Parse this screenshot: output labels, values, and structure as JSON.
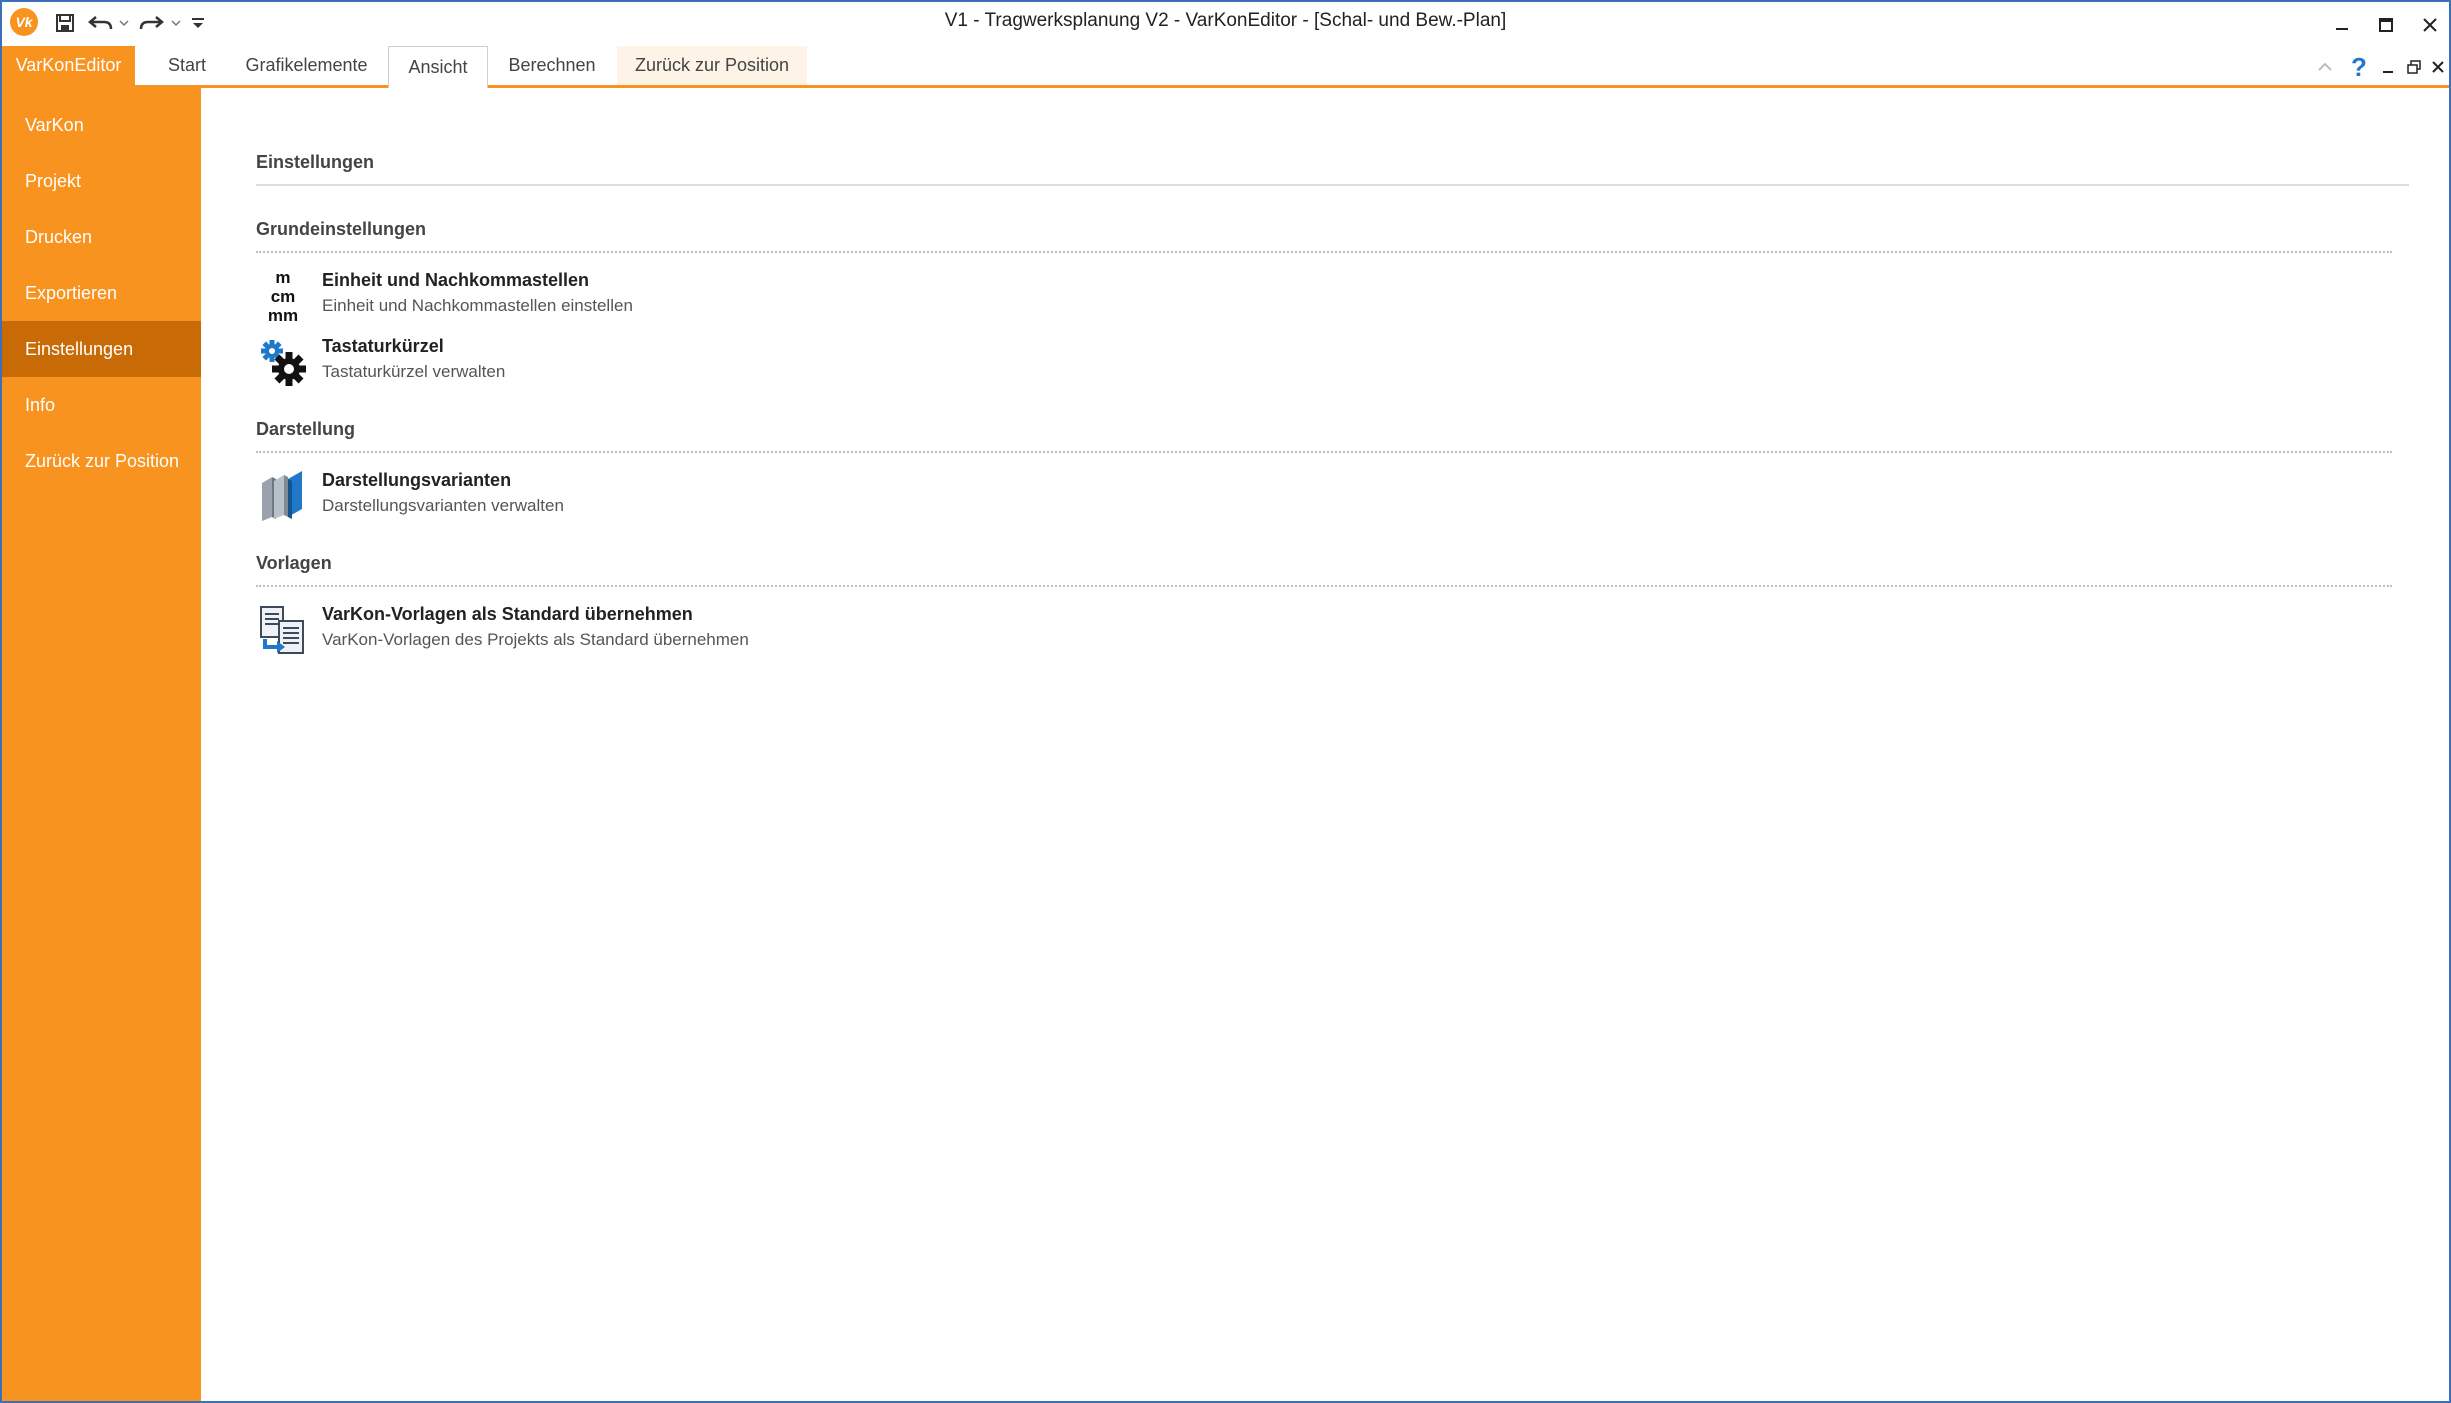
{
  "window": {
    "title": "V1 - Tragwerksplanung V2 - VarKonEditor - [Schal- und Bew.-Plan]",
    "logo_text": "Vk"
  },
  "ribbon": {
    "tabs": [
      {
        "label": "VarKonEditor"
      },
      {
        "label": "Start"
      },
      {
        "label": "Grafikelemente"
      },
      {
        "label": "Ansicht"
      },
      {
        "label": "Berechnen"
      },
      {
        "label": "Zurück zur Position"
      }
    ],
    "help_label": "?"
  },
  "sidebar": {
    "items": [
      {
        "label": "VarKon"
      },
      {
        "label": "Projekt"
      },
      {
        "label": "Drucken"
      },
      {
        "label": "Exportieren"
      },
      {
        "label": "Einstellungen"
      },
      {
        "label": "Info"
      },
      {
        "label": "Zurück zur Position"
      }
    ],
    "active_index": 4
  },
  "main": {
    "title": "Einstellungen",
    "sections": [
      {
        "title": "Grundeinstellungen",
        "entries": [
          {
            "title": "Einheit und Nachkommastellen",
            "description": "Einheit und Nachkommastellen einstellen",
            "icon": "units-icon",
            "icon_lines": [
              "m",
              "cm",
              "mm"
            ]
          },
          {
            "title": "Tastaturkürzel",
            "description": "Tastaturkürzel verwalten",
            "icon": "gears-icon"
          }
        ]
      },
      {
        "title": "Darstellung",
        "entries": [
          {
            "title": "Darstellungsvarianten",
            "description": "Darstellungsvarianten verwalten",
            "icon": "panels-icon"
          }
        ]
      },
      {
        "title": "Vorlagen",
        "entries": [
          {
            "title": "VarKon-Vorlagen als Standard übernehmen",
            "description": "VarKon-Vorlagen des Projekts als Standard übernehmen",
            "icon": "documents-copy-icon"
          }
        ]
      }
    ]
  },
  "colors": {
    "accent": "#f7931e",
    "active_nav": "#c86a06",
    "window_border": "#3d6fb8",
    "icon_blue": "#1f78c8"
  }
}
